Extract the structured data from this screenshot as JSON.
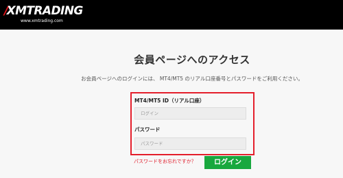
{
  "header": {
    "logo_slash": "/",
    "logo_text": "XMTRADING",
    "logo_url": "www.xmtrading.com"
  },
  "main": {
    "title": "会員ページへのアクセス",
    "intro": "お会員ページへのログインには、 MT4/MT5 のリアル口座番号とパスワードをご利用ください。"
  },
  "form": {
    "id_label": "MT4/MT5 ID（リアル口座）",
    "id_placeholder": "ログイン",
    "password_label": "パスワード",
    "password_placeholder": "パスワード",
    "forgot_link": "パスワードをお忘れですか？",
    "login_button": "ログイン"
  },
  "colors": {
    "header_bg": "#000000",
    "brand_red": "#e41e2b",
    "login_green": "#18a83e",
    "link_red": "#e0202e"
  }
}
